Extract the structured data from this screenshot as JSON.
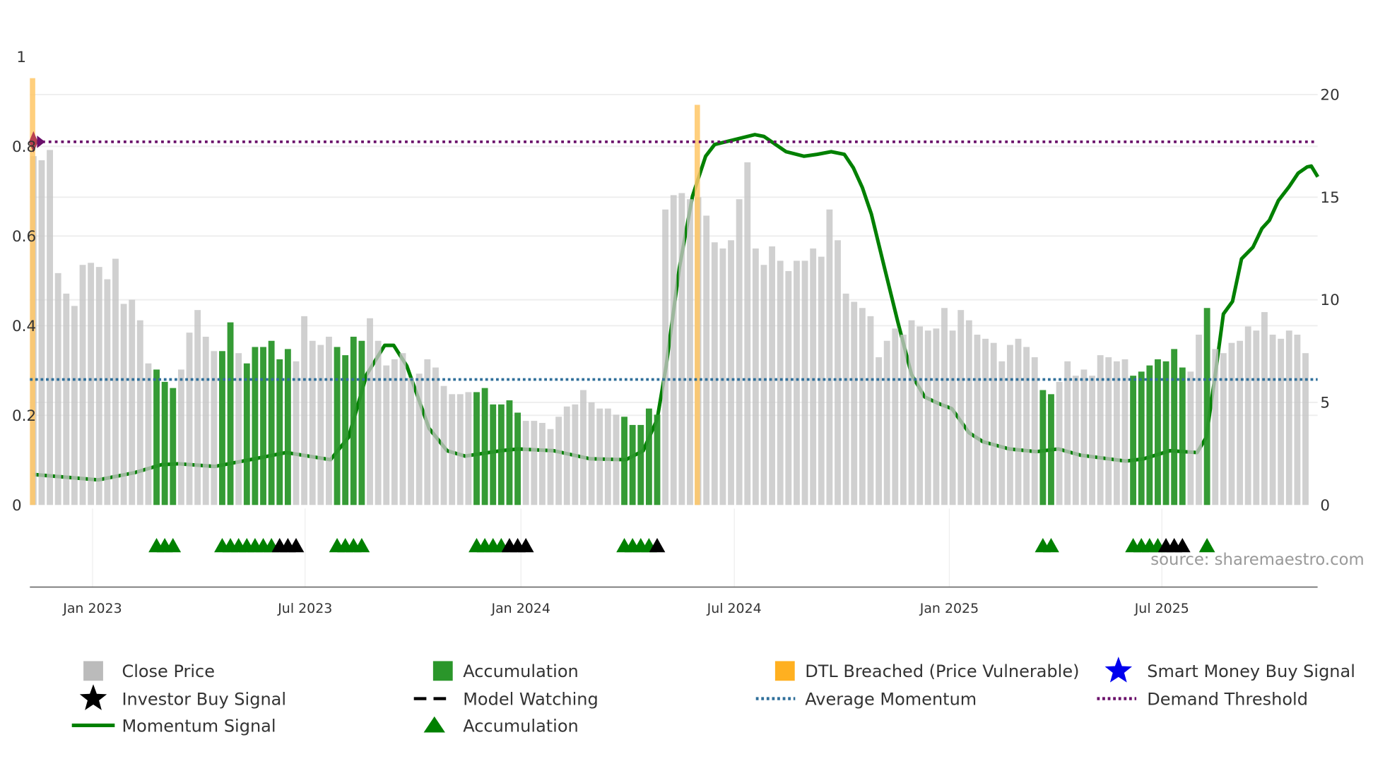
{
  "chart_data": {
    "type": "bar",
    "title": "",
    "source": "source: sharemaestro.com",
    "x_ticks": [
      "Jan 2023",
      "Jul 2023",
      "Jan 2024",
      "Jul 2024",
      "Jan 2025",
      "Jul 2025"
    ],
    "x_tick_weeks": [
      7.2,
      33.1,
      59.4,
      85.4,
      111.6,
      137.5
    ],
    "left_axis": {
      "ticks": [
        "0",
        "0.2",
        "0.4",
        "0.6",
        "0.8",
        "1"
      ],
      "values": [
        0,
        0.2,
        0.4,
        0.6,
        0.8,
        1
      ],
      "range": [
        0,
        1
      ]
    },
    "right_axis": {
      "ticks": [
        "0",
        "5",
        "10",
        "15",
        "20"
      ],
      "values": [
        0,
        5,
        10,
        15,
        20
      ],
      "range": [
        0,
        20
      ]
    },
    "close_price": [
      17.0,
      16.8,
      17.3,
      11.3,
      10.3,
      9.7,
      11.7,
      11.8,
      11.6,
      11.0,
      12.0,
      9.8,
      10.0,
      9.0,
      6.9,
      6.6,
      6.0,
      5.7,
      6.6,
      8.4,
      9.5,
      8.2,
      7.5,
      7.5,
      8.9,
      7.4,
      6.9,
      7.7,
      7.7,
      8.0,
      7.1,
      7.6,
      7.0,
      9.2,
      8.0,
      7.8,
      8.2,
      7.7,
      7.3,
      8.2,
      8.0,
      9.1,
      8.0,
      6.8,
      7.1,
      7.4,
      6.2,
      6.4,
      7.1,
      6.7,
      5.8,
      5.4,
      5.4,
      5.5,
      5.5,
      5.7,
      4.9,
      4.9,
      5.1,
      4.5,
      4.1,
      4.1,
      4.0,
      3.7,
      4.3,
      4.8,
      4.9,
      5.6,
      5.0,
      4.7,
      4.7,
      4.4,
      4.3,
      3.9,
      3.9,
      4.7,
      4.4,
      14.4,
      15.1,
      15.2,
      14.9,
      15.0,
      14.1,
      12.8,
      12.5,
      12.9,
      14.9,
      16.7,
      12.5,
      11.7,
      12.6,
      11.9,
      11.4,
      11.9,
      11.9,
      12.5,
      12.1,
      14.4,
      12.9,
      10.3,
      9.9,
      9.6,
      9.2,
      7.2,
      8.0,
      8.6,
      8.3,
      9.0,
      8.7,
      8.5,
      8.6,
      9.6,
      8.5,
      9.5,
      9.0,
      8.3,
      8.1,
      7.9,
      7.0,
      7.8,
      8.1,
      7.7,
      7.2,
      5.6,
      5.4,
      6.0,
      7.0,
      6.3,
      6.6,
      6.3,
      7.3,
      7.2,
      7.0,
      7.1,
      6.3,
      6.5,
      6.8,
      7.1,
      7.0,
      7.6,
      6.7,
      6.5,
      8.3,
      9.6,
      7.6,
      7.4,
      7.9,
      8.0,
      8.7,
      8.5,
      9.4,
      8.3,
      8.1,
      8.5,
      8.3,
      7.4
    ],
    "accumulation_weeks": [
      15,
      16,
      17,
      23,
      24,
      26,
      27,
      28,
      29,
      30,
      31,
      37,
      38,
      39,
      40,
      54,
      55,
      56,
      57,
      58,
      59,
      72,
      73,
      74,
      75,
      76,
      123,
      124,
      134,
      135,
      136,
      137,
      138,
      139,
      140,
      143
    ],
    "dtl_breached_weeks": [
      0,
      81
    ],
    "dtl_breached_price": [
      20.8,
      19.5
    ],
    "momentum_signal": [
      [
        0,
        0.068
      ],
      [
        7.9,
        0.056
      ],
      [
        12.3,
        0.072
      ],
      [
        15.6,
        0.09
      ],
      [
        17.7,
        0.092
      ],
      [
        22.1,
        0.086
      ],
      [
        26.4,
        0.101
      ],
      [
        30.8,
        0.117
      ],
      [
        36.2,
        0.101
      ],
      [
        38.4,
        0.151
      ],
      [
        40.6,
        0.291
      ],
      [
        42.8,
        0.356
      ],
      [
        43.9,
        0.356
      ],
      [
        45.5,
        0.31
      ],
      [
        48.2,
        0.171
      ],
      [
        50.4,
        0.121
      ],
      [
        52.6,
        0.109
      ],
      [
        56.9,
        0.121
      ],
      [
        59.1,
        0.125
      ],
      [
        63.4,
        0.121
      ],
      [
        67.8,
        0.103
      ],
      [
        72.2,
        0.101
      ],
      [
        74.3,
        0.121
      ],
      [
        76.0,
        0.191
      ],
      [
        77.1,
        0.31
      ],
      [
        78.7,
        0.529
      ],
      [
        80.3,
        0.689
      ],
      [
        81.9,
        0.778
      ],
      [
        83.0,
        0.804
      ],
      [
        85.2,
        0.814
      ],
      [
        87.9,
        0.826
      ],
      [
        89.0,
        0.822
      ],
      [
        91.7,
        0.788
      ],
      [
        93.9,
        0.778
      ],
      [
        95.5,
        0.782
      ],
      [
        97.2,
        0.788
      ],
      [
        98.8,
        0.782
      ],
      [
        99.9,
        0.752
      ],
      [
        101.0,
        0.708
      ],
      [
        102.1,
        0.649
      ],
      [
        103.7,
        0.529
      ],
      [
        105.3,
        0.41
      ],
      [
        107.0,
        0.291
      ],
      [
        108.6,
        0.241
      ],
      [
        110.2,
        0.227
      ],
      [
        111.9,
        0.215
      ],
      [
        114.0,
        0.161
      ],
      [
        115.7,
        0.141
      ],
      [
        118.9,
        0.125
      ],
      [
        122.2,
        0.119
      ],
      [
        124.9,
        0.125
      ],
      [
        127.6,
        0.111
      ],
      [
        133.1,
        0.098
      ],
      [
        135.3,
        0.103
      ],
      [
        138.5,
        0.121
      ],
      [
        141.8,
        0.117
      ],
      [
        142.9,
        0.151
      ],
      [
        144.0,
        0.291
      ],
      [
        145.0,
        0.426
      ],
      [
        146.1,
        0.454
      ],
      [
        147.2,
        0.549
      ],
      [
        148.6,
        0.575
      ],
      [
        149.7,
        0.617
      ],
      [
        150.6,
        0.635
      ],
      [
        151.7,
        0.679
      ],
      [
        153.0,
        0.71
      ],
      [
        154.1,
        0.74
      ],
      [
        155.2,
        0.754
      ],
      [
        155.7,
        0.756
      ],
      [
        156.5,
        0.732
      ]
    ],
    "average_momentum": 0.28,
    "demand_threshold": 0.81,
    "accumulation_signal_weeks": [
      15,
      16,
      17,
      23,
      24,
      25,
      26,
      27,
      28,
      29,
      37,
      38,
      39,
      40,
      54,
      55,
      56,
      57,
      72,
      73,
      74,
      75,
      123,
      124,
      134,
      135,
      136,
      137,
      143
    ],
    "investor_buy_signal_weeks": [
      30,
      31,
      32,
      58,
      59,
      60,
      76,
      138,
      139,
      140
    ],
    "legend": {
      "placement": "bottom",
      "items": [
        {
          "label": "Close Price",
          "icon": "grey-square"
        },
        {
          "label": "Accumulation",
          "icon": "green-square"
        },
        {
          "label": "DTL Breached (Price Vulnerable)",
          "icon": "orange-square"
        },
        {
          "label": "Smart Money Buy Signal",
          "icon": "blue-star"
        },
        {
          "label": "Investor Buy Signal",
          "icon": "black-star"
        },
        {
          "label": "Model Watching",
          "icon": "black-dashed-line"
        },
        {
          "label": "Average Momentum",
          "icon": "blue-dotted-line"
        },
        {
          "label": "Demand Threshold",
          "icon": "purple-dotted-line"
        },
        {
          "label": "Momentum Signal",
          "icon": "green-line"
        },
        {
          "label": "Accumulation",
          "icon": "green-triangle"
        }
      ]
    },
    "colors": {
      "price": "#c4c4c4",
      "accumulation": "#2a962a",
      "dtl": "#ffc766",
      "momentum": "#008000",
      "average": "#2f6f9a",
      "demand": "#6a0f6a",
      "smart_money": "#0000ee",
      "investor": "#000000"
    }
  }
}
